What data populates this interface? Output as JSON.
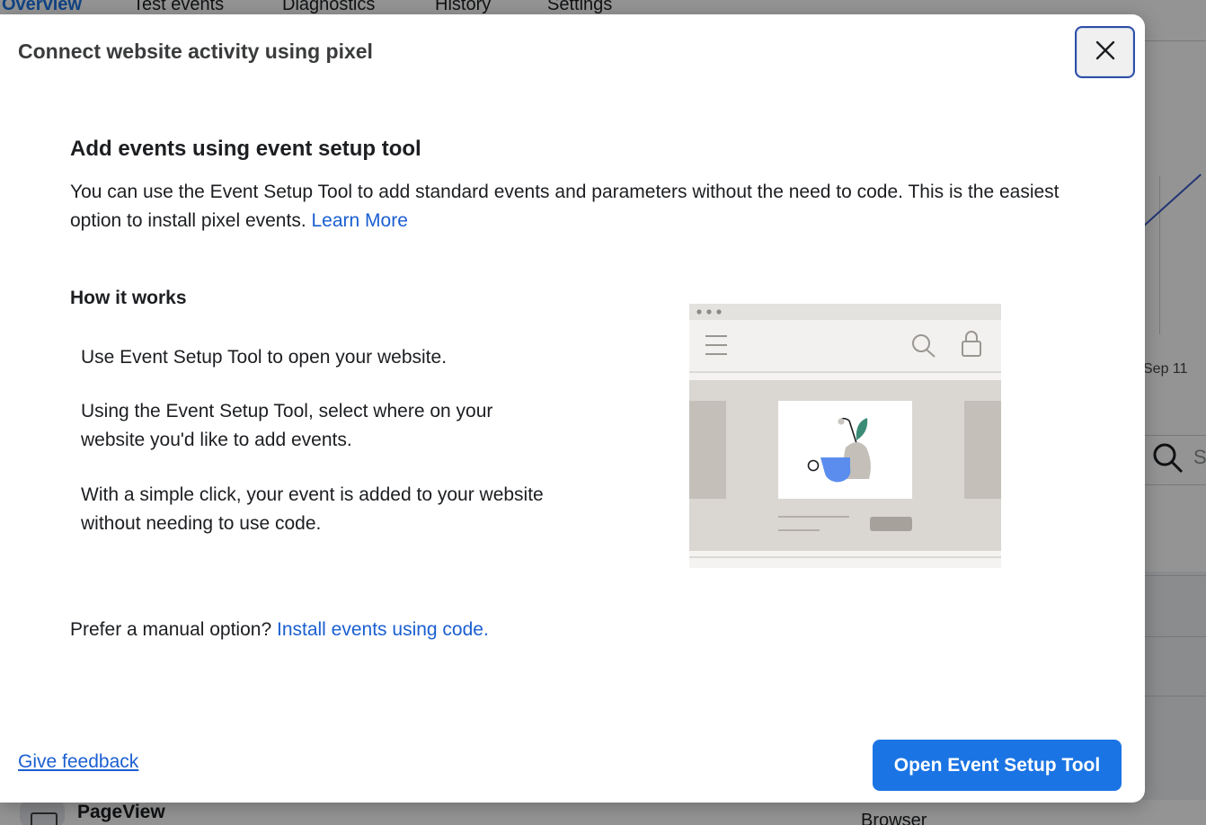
{
  "background": {
    "tabs": [
      "Overview",
      "Test events",
      "Diagnostics",
      "History",
      "Settings"
    ],
    "chart_date_label": "Sep 11",
    "search_partial": "S",
    "event_row_label": "PageView",
    "event_row_source": "Browser"
  },
  "modal": {
    "title": "Connect website activity using pixel",
    "section_title": "Add events using event setup tool",
    "intro_text": "You can use the Event Setup Tool to add standard events and parameters without the need to code. This is the easiest option to install pixel events.",
    "intro_link": "Learn More",
    "how_title": "How it works",
    "steps": [
      "Use Event Setup Tool to open your website.",
      "Using the Event Setup Tool, select where on your website you'd like to add events.",
      "With a simple click, your event is added to your website without needing to use code."
    ],
    "manual_prefix": "Prefer a manual option?",
    "manual_link": "Install events using code.",
    "feedback_link": "Give feedback",
    "primary_button": "Open Event Setup Tool"
  },
  "colors": {
    "primary": "#1b74e4",
    "link": "#1b5fd1",
    "close_border": "#2d4fa8"
  }
}
